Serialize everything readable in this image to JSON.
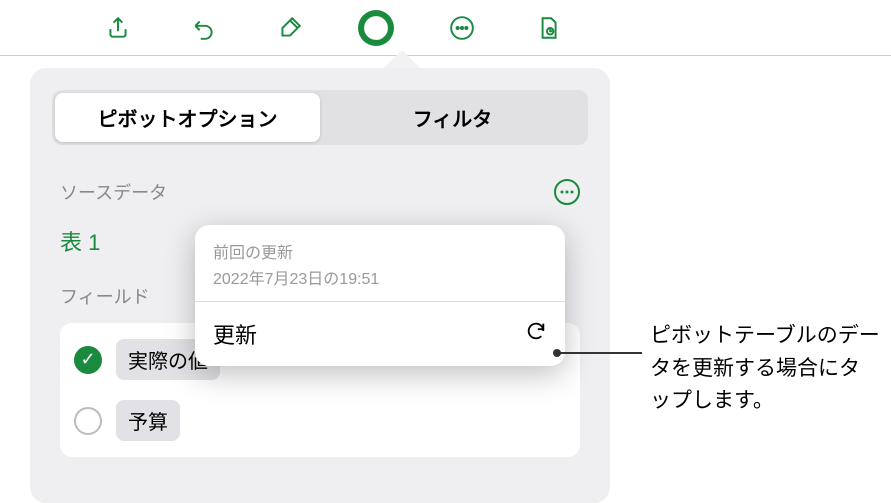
{
  "tabs": {
    "pivot": "ピボットオプション",
    "filter": "フィルタ"
  },
  "source": {
    "label": "ソースデータ",
    "table": "表 1"
  },
  "fields": {
    "label": "フィールド",
    "items": [
      {
        "name": "実際の値",
        "checked": true
      },
      {
        "name": "予算",
        "checked": false
      }
    ]
  },
  "popup": {
    "last_label": "前回の更新",
    "last_date": "2022年7月23日の19:51",
    "refresh": "更新"
  },
  "annotation": "ピボットテーブルのデータを更新する場合にタップします。"
}
